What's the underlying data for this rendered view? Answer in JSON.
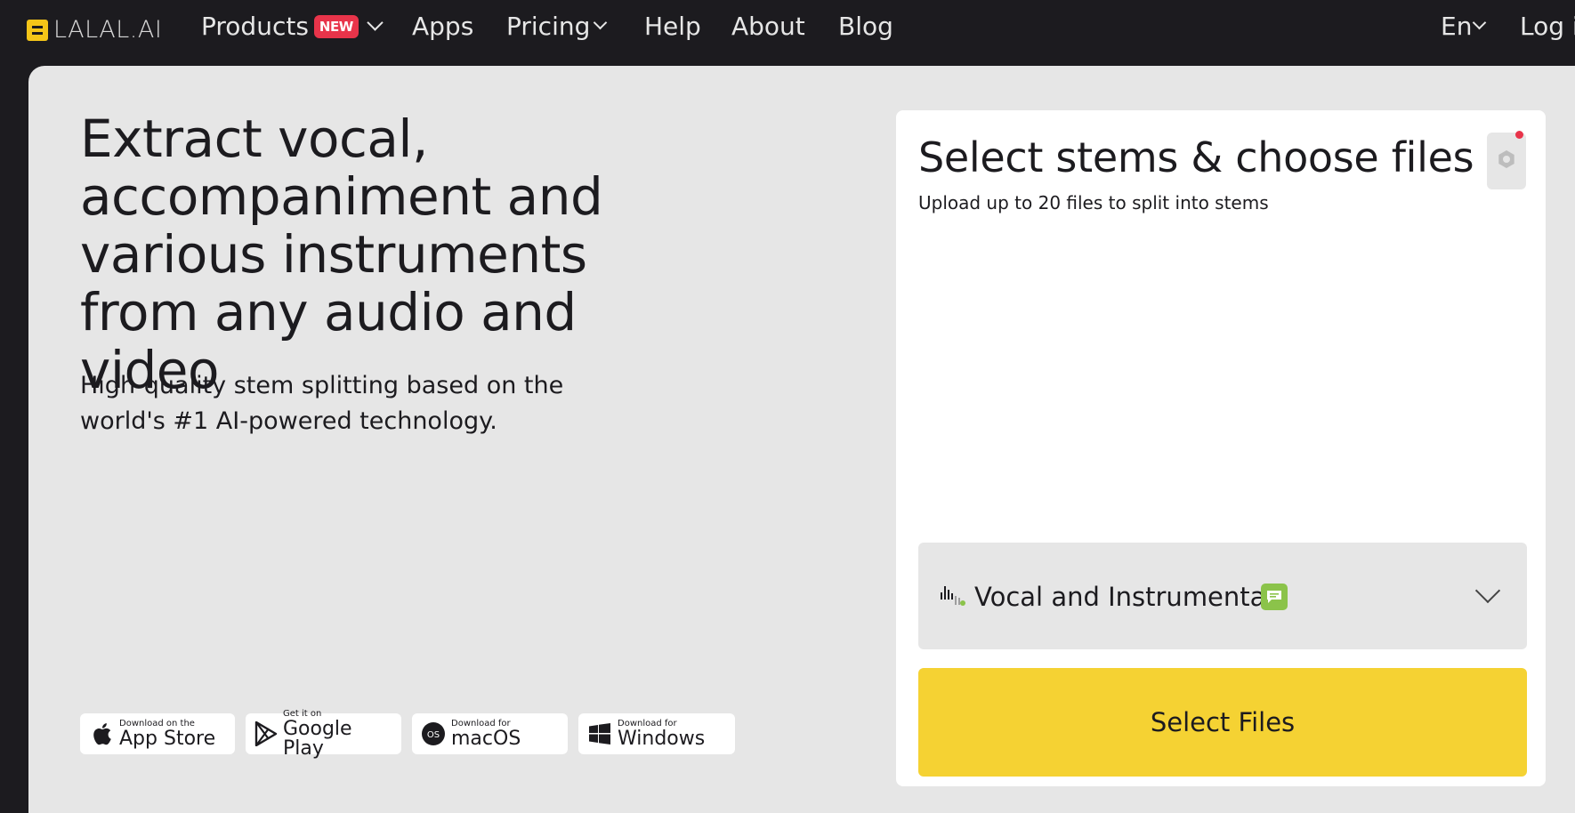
{
  "nav": {
    "logo": "LALAL.AI",
    "items": [
      {
        "label": "Products",
        "badge": "NEW"
      },
      {
        "label": "Apps"
      },
      {
        "label": "Pricing"
      },
      {
        "label": "Help"
      },
      {
        "label": "About"
      },
      {
        "label": "Blog"
      }
    ],
    "language": "En",
    "login": "Log i"
  },
  "hero": {
    "headline": "Extract vocal, accompaniment and various instruments from any audio and video",
    "subline": "High-quality stem splitting based on the world's #1 AI-powered technology."
  },
  "stores": [
    {
      "small": "Download on the",
      "big": "App Store",
      "icon": "apple-icon"
    },
    {
      "small": "Get it on",
      "big": "Google Play",
      "icon": "google-play-icon"
    },
    {
      "small": "Download for",
      "big": "macOS",
      "icon": "macos-icon"
    },
    {
      "small": "Download for",
      "big": "Windows",
      "icon": "windows-icon"
    }
  ],
  "upload": {
    "title": "Select stems & choose files",
    "subtitle": "Upload up to 20 files to split into stems",
    "stem_option": "Vocal and Instrumental",
    "select_button": "Select Files"
  },
  "colors": {
    "accent_yellow": "#f5d233",
    "badge_red": "#e8344a",
    "stem_badge_green": "#8bc34a",
    "background_dark": "#1c1b1f",
    "panel_grey": "#e6e6e6"
  }
}
